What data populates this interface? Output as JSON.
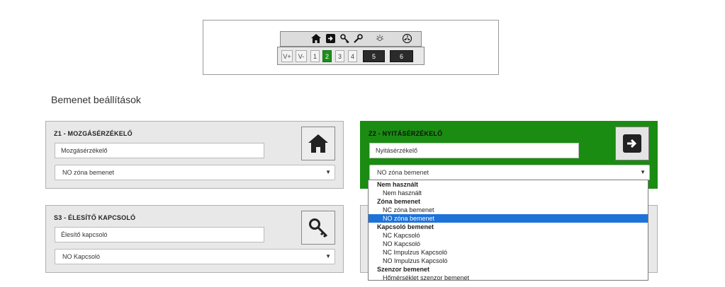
{
  "keypad": {
    "top_icons": [
      "home-icon",
      "enter-icon",
      "key-icon",
      "wrench-icon",
      "light-icon",
      "fan-icon"
    ],
    "buttons": [
      {
        "label": "V+",
        "state": "normal"
      },
      {
        "label": "V-",
        "state": "normal"
      },
      {
        "label": "1",
        "state": "normal"
      },
      {
        "label": "2",
        "state": "active"
      },
      {
        "label": "3",
        "state": "normal"
      },
      {
        "label": "4",
        "state": "normal"
      },
      {
        "label": "5",
        "state": "dark"
      },
      {
        "label": "6",
        "state": "dark"
      }
    ]
  },
  "page": {
    "section_title": "Bemenet beállítások"
  },
  "panels": [
    {
      "title": "Z1 - MOZGÁSÉRZÉKELŐ",
      "name": "Mozgásérzékelő",
      "type_value": "NO zóna bemenet",
      "icon": "home-icon",
      "highlight": false
    },
    {
      "title": "Z2 - NYITÁSÉRZÉKELŐ",
      "name": "Nyitásérzékelő",
      "type_value": "NO zóna bemenet",
      "icon": "enter-icon",
      "highlight": true,
      "highlight_color": "#1a8c12"
    },
    {
      "title": "S3 - ÉLESÍTŐ KAPCSOLÓ",
      "name": "Élesítő kapcsoló",
      "type_value": "NO Kapcsoló",
      "icon": "key-icon",
      "highlight": false
    }
  ],
  "dropdown": {
    "items": [
      {
        "kind": "group",
        "label": "Nem használt"
      },
      {
        "kind": "option",
        "label": "Nem használt"
      },
      {
        "kind": "group",
        "label": "Zóna bemenet"
      },
      {
        "kind": "option",
        "label": "NC zóna bemenet"
      },
      {
        "kind": "option",
        "label": "NO zóna bemenet",
        "selected": true
      },
      {
        "kind": "group",
        "label": "Kapcsoló bemenet"
      },
      {
        "kind": "option",
        "label": "NC Kapcsoló"
      },
      {
        "kind": "option",
        "label": "NO Kapcsoló"
      },
      {
        "kind": "option",
        "label": "NC Impulzus Kapcsoló"
      },
      {
        "kind": "option",
        "label": "NO Impulzus Kapcsoló"
      },
      {
        "kind": "group",
        "label": "Szenzor bemenet"
      },
      {
        "kind": "option",
        "label": "Hőmérséklet szenzor bemenet"
      }
    ],
    "selected_color": "#1e73d8"
  }
}
